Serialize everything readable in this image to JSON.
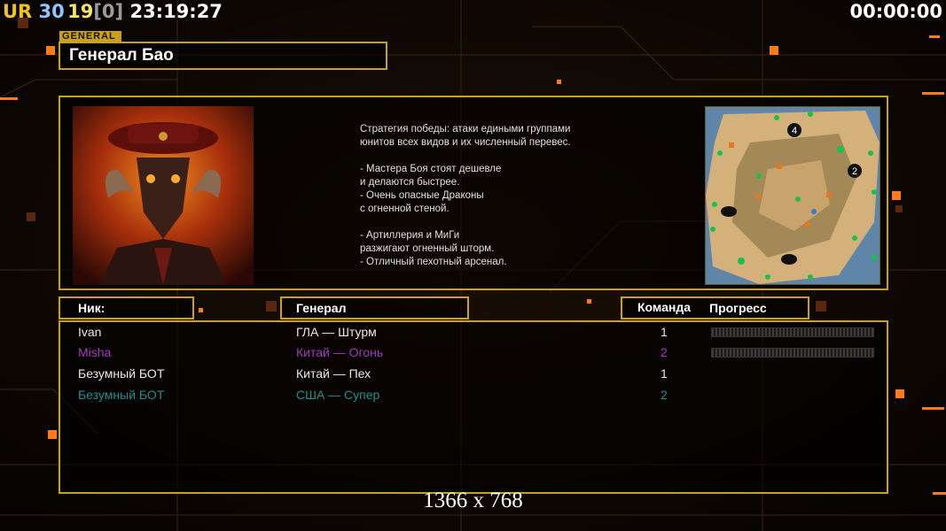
{
  "hud": {
    "ur": "UR",
    "n1": "30",
    "n2": "19",
    "bracket": "[0]",
    "clock": "23:19:27",
    "timer": "00:00:00"
  },
  "general": {
    "tag": "GENERAL",
    "title": "Генерал Бао",
    "description": "Стратегия победы: атаки едиными группами\nюнитов всех видов и их численный перевес.\n\n- Мастера Боя стоят дешевле\nи делаются быстрее.\n- Очень опасные Драконы\nс огненной стеной.\n\n- Артиллерия и МиГи\nразжигают огненный шторм.\n- Отличный пехотный арсенал."
  },
  "table": {
    "headers": {
      "nick": "Ник:",
      "general": "Генерал",
      "team": "Команда",
      "progress": "Прогресс"
    },
    "rows": [
      {
        "nick": "Ivan",
        "general": "ГЛА — Штурм",
        "team": "1",
        "color": "#ffffff",
        "progress": 0
      },
      {
        "nick": "Misha",
        "general": "Китай — Огонь",
        "team": "2",
        "color": "#a23bc4",
        "progress": 0
      },
      {
        "nick": "Безумный БОТ",
        "general": "Китай — Пех",
        "team": "1",
        "color": "#ffffff"
      },
      {
        "nick": "Безумный БОТ",
        "general": "США — Супер",
        "team": "2",
        "color": "#1f8f8f"
      }
    ]
  },
  "map": {
    "start_positions": [
      "4",
      "2"
    ]
  },
  "resolution": "1366 x 768",
  "colors": {
    "frame": "#c9a11b",
    "ur": "#f2c21a",
    "n1": "#8fc5ff",
    "n2": "#f5e36a",
    "bracket": "#9a9a9a"
  }
}
